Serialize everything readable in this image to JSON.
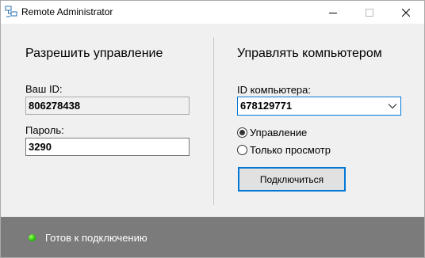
{
  "window": {
    "title": "Remote Administrator"
  },
  "allow_control": {
    "heading": "Разрешить управление",
    "your_id_label": "Ваш ID:",
    "your_id_value": "806278438",
    "password_label": "Пароль:",
    "password_value": "3290"
  },
  "control_computer": {
    "heading": "Управлять компьютером",
    "computer_id_label": "ID компьютера:",
    "computer_id_value": "678129771",
    "mode_options": [
      {
        "label": "Управление",
        "selected": true
      },
      {
        "label": "Только просмотр",
        "selected": false
      }
    ],
    "connect_button": "Подключиться"
  },
  "status": {
    "text": "Готов к подключению",
    "indicator_color": "#25c200"
  },
  "colors": {
    "accent": "#0078d7",
    "statusbar": "#7b7b7b"
  }
}
